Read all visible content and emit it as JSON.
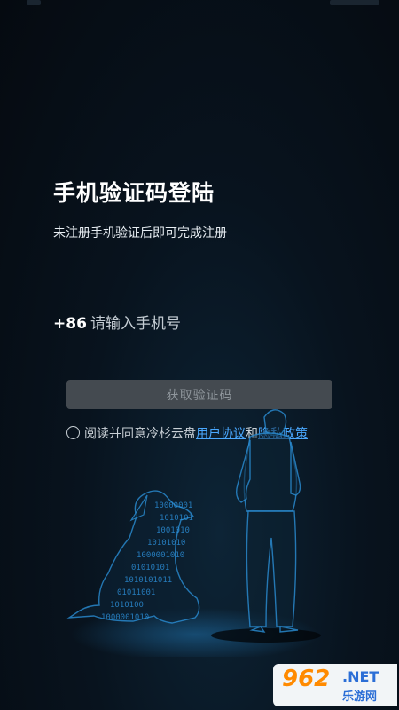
{
  "login": {
    "title": "手机验证码登陆",
    "subtitle": "未注册手机验证后即可完成注册"
  },
  "phone": {
    "country_code": "+86",
    "placeholder": "请输入手机号"
  },
  "buttons": {
    "get_code": "获取验证码"
  },
  "agreement": {
    "prefix": "阅读并同意冷杉云盘",
    "terms": "用户协议",
    "and": "和",
    "privacy": "隐私政策"
  },
  "illustration": {
    "binary_rows": [
      "10000001",
      "1010101",
      "1001010",
      "10101010",
      "1000001010",
      "01010101",
      "1010101011",
      "01011001",
      "1010100",
      "1000001010"
    ]
  },
  "watermark": {
    "number": "962",
    "net": ".NET",
    "site": "乐游网"
  },
  "colors": {
    "link": "#4aa8ff",
    "button_bg": "#444a50",
    "illustration": "#2a8fd6"
  }
}
